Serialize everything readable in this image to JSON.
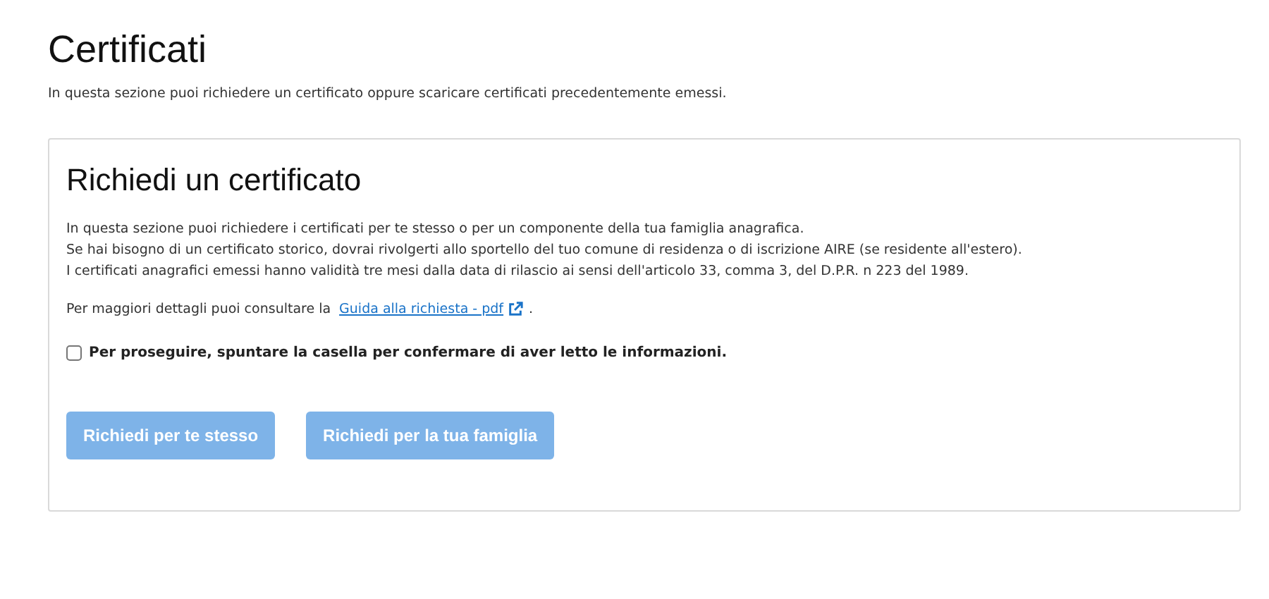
{
  "page": {
    "title": "Certificati",
    "intro": "In questa sezione puoi richiedere un certificato oppure scaricare certificati precedentemente emessi."
  },
  "card": {
    "title": "Richiedi un certificato",
    "paragraphs": [
      "In questa sezione puoi richiedere i certificati per te stesso o per un componente della tua famiglia anagrafica.",
      "Se hai bisogno di un certificato storico, dovrai rivolgerti allo sportello del tuo comune di residenza o di iscrizione AIRE (se residente all'estero).",
      "I certificati anagrafici emessi hanno validità tre mesi dalla data di rilascio ai sensi dell'articolo 33, comma 3, del D.P.R. n 223 del 1989."
    ],
    "details": {
      "text": "Per maggiori dettagli puoi consultare la",
      "link": "Guida alla richiesta - pdf",
      "suffix": "."
    },
    "confirm": {
      "label": "Per proseguire, spuntare la casella per confermare di aver letto le informazioni.",
      "checked": false
    },
    "buttons": [
      {
        "label": "Richiedi per te stesso",
        "disabled": true
      },
      {
        "label": "Richiedi per la tua famiglia",
        "disabled": true
      }
    ]
  }
}
